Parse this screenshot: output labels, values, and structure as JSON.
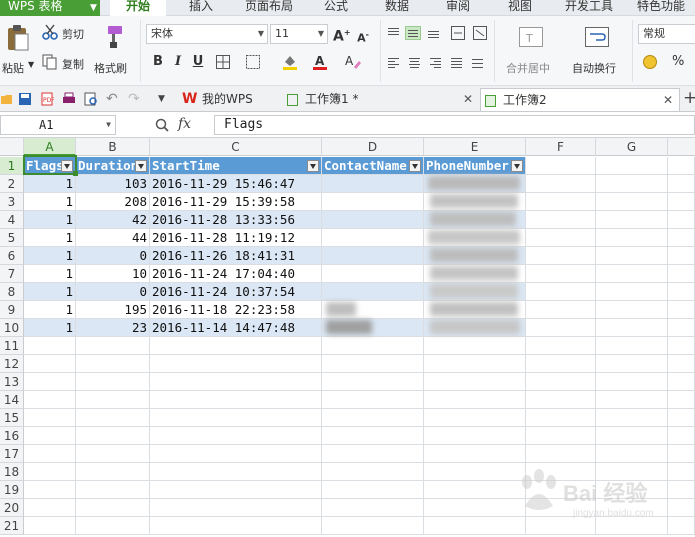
{
  "app": {
    "name": "WPS 表格"
  },
  "menu": {
    "tabs": [
      "开始",
      "插入",
      "页面布局",
      "公式",
      "数据",
      "审阅",
      "视图",
      "开发工具",
      "特色功能"
    ],
    "active": 0
  },
  "ribbon": {
    "paste": "粘贴",
    "cut": "剪切",
    "copy": "复制",
    "format_painter": "格式刷",
    "font_name": "宋体",
    "font_size": "11",
    "bold": "B",
    "italic": "I",
    "underline": "U",
    "grow_font": "A",
    "shrink_font": "A",
    "merge_center": "合并居中",
    "wrap_text": "自动换行",
    "number_format": "常规",
    "percent": "%"
  },
  "doc_tabs": [
    {
      "label": "我的WPS",
      "active": false
    },
    {
      "label": "工作簿1 *",
      "active": false
    },
    {
      "label": "工作簿2",
      "active": true
    }
  ],
  "formula_bar": {
    "cell_ref": "A1",
    "fx": "fx",
    "content": "Flags"
  },
  "sheet": {
    "columns": [
      "A",
      "B",
      "C",
      "D",
      "E",
      "F",
      "G"
    ],
    "selected_col": "A",
    "selected_row": 1,
    "headers": [
      "Flags",
      "Duration",
      "StartTime",
      "ContactName",
      "PhoneNumber"
    ],
    "row_numbers": [
      "1",
      "2",
      "3",
      "4",
      "5",
      "6",
      "7",
      "8",
      "9",
      "10",
      "11",
      "12",
      "13",
      "14",
      "15",
      "16",
      "17",
      "18",
      "19",
      "20",
      "21"
    ],
    "rows": [
      {
        "flags": "1",
        "duration": "103",
        "start": "2016-11-29 15:46:47"
      },
      {
        "flags": "1",
        "duration": "208",
        "start": "2016-11-29 15:39:58"
      },
      {
        "flags": "1",
        "duration": "42",
        "start": "2016-11-28 13:33:56"
      },
      {
        "flags": "1",
        "duration": "44",
        "start": "2016-11-28 11:19:12"
      },
      {
        "flags": "1",
        "duration": "0",
        "start": "2016-11-26 18:41:31"
      },
      {
        "flags": "1",
        "duration": "10",
        "start": "2016-11-24 17:04:40"
      },
      {
        "flags": "1",
        "duration": "0",
        "start": "2016-11-24 10:37:54"
      },
      {
        "flags": "1",
        "duration": "195",
        "start": "2016-11-18 22:23:58"
      },
      {
        "flags": "1",
        "duration": "23",
        "start": "2016-11-14 14:47:48"
      }
    ]
  },
  "watermark": {
    "brand": "Bai 经验",
    "sub": "jingyan.baidu.com"
  },
  "colors": {
    "accent": "#4a9e36",
    "table_header": "#5b9bd5",
    "table_band": "#dbe7f4"
  }
}
